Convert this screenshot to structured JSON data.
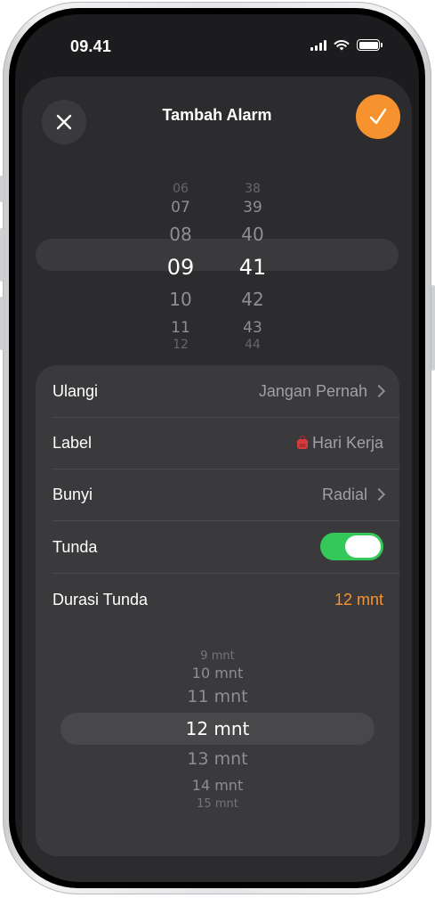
{
  "status_bar": {
    "time": "09.41"
  },
  "sheet": {
    "title": "Tambah Alarm"
  },
  "time_picker": {
    "hours": [
      "06",
      "07",
      "08",
      "09",
      "10",
      "11",
      "12"
    ],
    "minutes": [
      "38",
      "39",
      "40",
      "41",
      "42",
      "43",
      "44"
    ],
    "selected_hour": "09",
    "selected_minute": "41"
  },
  "settings": {
    "repeat": {
      "label": "Ulangi",
      "value": "Jangan Pernah"
    },
    "label": {
      "label": "Label",
      "value": "Hari Kerja",
      "icon": "backpack-icon"
    },
    "sound": {
      "label": "Bunyi",
      "value": "Radial"
    },
    "snooze": {
      "label": "Tunda",
      "enabled": true
    },
    "snooze_duration": {
      "label": "Durasi Tunda",
      "value": "12 mnt"
    }
  },
  "snooze_picker": {
    "items": [
      "9 mnt",
      "10 mnt",
      "11 mnt",
      "12 mnt",
      "13 mnt",
      "14 mnt",
      "15 mnt"
    ],
    "selected": "12 mnt"
  },
  "colors": {
    "accent": "#f7932f",
    "toggle_on": "#34c759",
    "background": "#1c1c1e"
  }
}
